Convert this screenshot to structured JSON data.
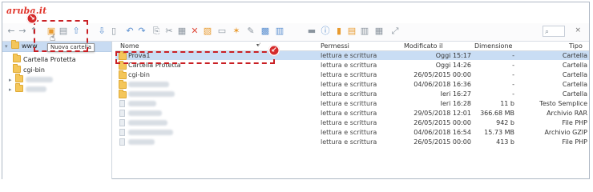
{
  "brand": {
    "logo": "aruba.it"
  },
  "toolbar": {
    "tooltip": "Nuova cartella",
    "search_icon": "⌕",
    "clear_icon": "×"
  },
  "sidebar": {
    "root_label": "www",
    "items": [
      {
        "label": "Cartella Protetta",
        "icon": "folder-icon"
      },
      {
        "label": "cgi-bin",
        "icon": "folder-icon"
      },
      {
        "label": "",
        "icon": "folder-icon",
        "blurred": true
      },
      {
        "label": "",
        "icon": "folder-icon",
        "blurred": true
      }
    ]
  },
  "table": {
    "headers": {
      "name": "Nome",
      "permissions": "Permessi",
      "modified": "Modificato il",
      "size": "Dimensione",
      "type": "Tipo"
    },
    "rows": [
      {
        "name": "Prova1",
        "perm": "lettura e scrittura",
        "mod": "Oggi 15:17",
        "size": "-",
        "type": "Cartella",
        "kind": "folder",
        "selected": true
      },
      {
        "name": "Cartella Protetta",
        "perm": "lettura e scrittura",
        "mod": "Oggi 14:26",
        "size": "-",
        "type": "Cartella",
        "kind": "folder"
      },
      {
        "name": "cgi-bin",
        "perm": "lettura e scrittura",
        "mod": "26/05/2015 00:00",
        "size": "-",
        "type": "Cartella",
        "kind": "folder"
      },
      {
        "name": "",
        "perm": "lettura e scrittura",
        "mod": "04/06/2018 16:36",
        "size": "-",
        "type": "Cartella",
        "kind": "folder",
        "blurred": true
      },
      {
        "name": "",
        "perm": "lettura e scrittura",
        "mod": "Ieri 16:27",
        "size": "-",
        "type": "Cartella",
        "kind": "folder",
        "blurred": true
      },
      {
        "name": "",
        "perm": "lettura e scrittura",
        "mod": "Ieri 16:28",
        "size": "11 b",
        "type": "Testo Semplice",
        "kind": "file",
        "blurred": true
      },
      {
        "name": "",
        "perm": "lettura e scrittura",
        "mod": "29/05/2018 12:01",
        "size": "366.68 MB",
        "type": "Archivio RAR",
        "kind": "file",
        "blurred": true
      },
      {
        "name": "",
        "perm": "lettura e scrittura",
        "mod": "26/05/2015 00:00",
        "size": "942 b",
        "type": "File PHP",
        "kind": "file",
        "blurred": true
      },
      {
        "name": "",
        "perm": "lettura e scrittura",
        "mod": "04/06/2018 16:54",
        "size": "15.73 MB",
        "type": "Archivio GZIP",
        "kind": "file",
        "blurred": true
      },
      {
        "name": "",
        "perm": "lettura e scrittura",
        "mod": "26/05/2015 00:00",
        "size": "413 b",
        "type": "File PHP",
        "kind": "file",
        "blurred": true
      }
    ]
  },
  "annotations": {
    "step_icon": "↘",
    "step_icon_2": "↙"
  },
  "colors": {
    "accent": "#d52a2a",
    "selection": "#c9ddf4",
    "folder": "#f4c65a"
  }
}
